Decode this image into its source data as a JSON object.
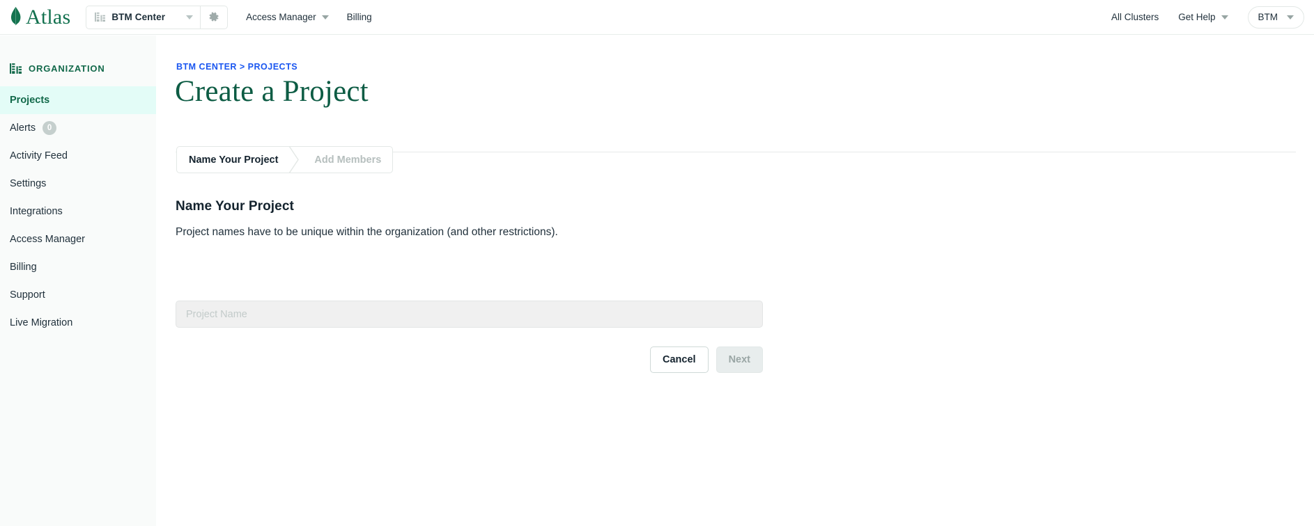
{
  "topnav": {
    "logo_text": "Atlas",
    "org_selector": {
      "name": "BTM Center",
      "icon": "building-icon",
      "caret": "chevron-down-icon"
    },
    "settings_icon": "gear-icon",
    "links": [
      {
        "label": "Access Manager",
        "has_caret": true
      },
      {
        "label": "Billing",
        "has_caret": false
      }
    ],
    "right_links": [
      {
        "label": "All Clusters",
        "has_caret": false
      },
      {
        "label": "Get Help",
        "has_caret": true
      }
    ],
    "user_menu": {
      "label": "BTM"
    }
  },
  "sidebar": {
    "section_icon": "building-icon",
    "section_title": "ORGANIZATION",
    "items": [
      {
        "label": "Projects",
        "active": true,
        "badge": null
      },
      {
        "label": "Alerts",
        "active": false,
        "badge": "0"
      },
      {
        "label": "Activity Feed",
        "active": false,
        "badge": null
      },
      {
        "label": "Settings",
        "active": false,
        "badge": null
      },
      {
        "label": "Integrations",
        "active": false,
        "badge": null
      },
      {
        "label": "Access Manager",
        "active": false,
        "badge": null
      },
      {
        "label": "Billing",
        "active": false,
        "badge": null
      },
      {
        "label": "Support",
        "active": false,
        "badge": null
      },
      {
        "label": "Live Migration",
        "active": false,
        "badge": null
      }
    ]
  },
  "main": {
    "breadcrumb": "BTM CENTER > PROJECTS",
    "page_title": "Create a Project",
    "steps": [
      {
        "label": "Name Your Project",
        "active": true
      },
      {
        "label": "Add Members",
        "active": false
      }
    ],
    "section_title": "Name Your Project",
    "section_description": "Project names have to be unique within the organization (and other restrictions).",
    "project_name_input": {
      "value": "",
      "placeholder": "Project Name"
    },
    "buttons": {
      "cancel": "Cancel",
      "next": "Next"
    }
  },
  "colors": {
    "brand_green": "#13714f",
    "dark_green": "#0d5c44",
    "active_item_bg": "#e3fcf7",
    "active_item_text": "#12694a",
    "breadcrumb_link": "#1a56f0",
    "sidebar_bg": "#f9fbfa",
    "input_bg": "#f0f0f0",
    "disabled_btn_bg": "#e8eded"
  }
}
